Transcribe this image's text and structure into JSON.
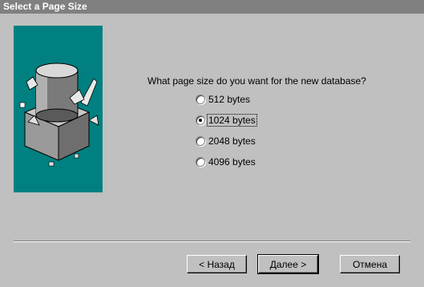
{
  "window": {
    "title": "Select a Page Size"
  },
  "illustration": {
    "name": "database-cube-icon",
    "background": "#008080"
  },
  "question": "What page size do you want for the new database?",
  "page_size_options": [
    {
      "label": "512 bytes",
      "checked": false
    },
    {
      "label": "1024 bytes",
      "checked": true
    },
    {
      "label": "2048 bytes",
      "checked": false
    },
    {
      "label": "4096 bytes",
      "checked": false
    }
  ],
  "buttons": {
    "back": "< Назад",
    "next": "Далее >",
    "cancel": "Отмена"
  },
  "colors": {
    "title_bar": "#808080",
    "face": "#c0c0c0"
  }
}
